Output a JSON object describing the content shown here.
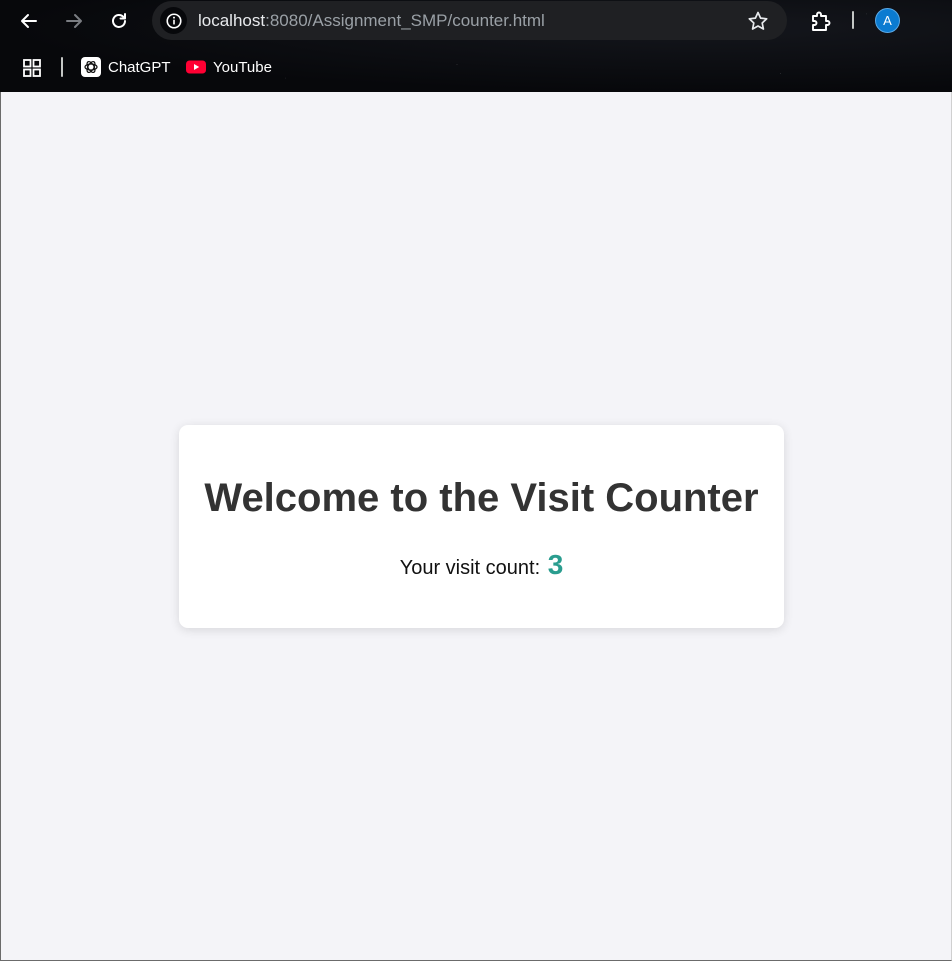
{
  "browser": {
    "url_host": "localhost",
    "url_path": ":8080/Assignment_SMP/counter.html",
    "profile_initial": "A",
    "bookmarks": [
      {
        "label": "ChatGPT",
        "icon": "chatgpt-icon"
      },
      {
        "label": "YouTube",
        "icon": "youtube-icon"
      }
    ]
  },
  "page": {
    "heading": "Welcome to the Visit Counter",
    "count_label": "Your visit count:",
    "count_value": "3"
  },
  "colors": {
    "page_background": "#f4f4f8",
    "card_background": "#ffffff",
    "heading": "#333333",
    "count_accent": "#2a9d8f",
    "avatar": "#0b7bd1",
    "youtube_red": "#ff0033"
  }
}
